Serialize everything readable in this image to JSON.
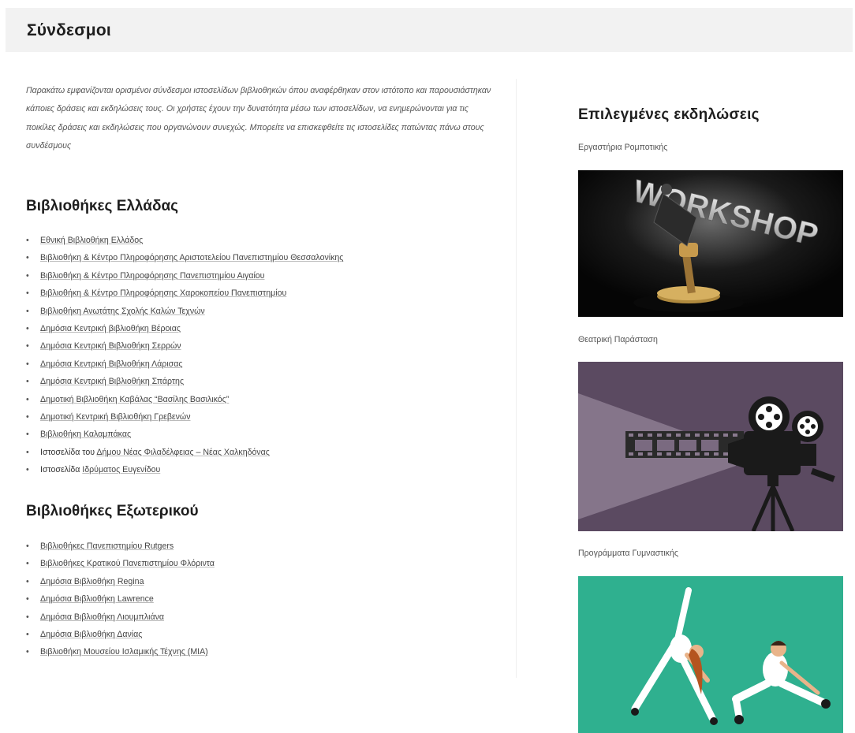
{
  "page": {
    "title": "Σύνδεσμοι",
    "intro": "Παρακάτω εμφανίζονται ορισμένοι σύνδεσμοι ιστοσελίδων βιβλιοθηκών όπου αναφέρθηκαν στον ιστότοπο και παρουσιάστηκαν κάποιες δράσεις και εκδηλώσεις τους. Οι χρήστες έχουν την δυνατότητα μέσω των ιστοσελίδων, να ενημερώνονται για τις ποικίλες δράσεις και εκδηλώσεις που οργανώνουν συνεχώς. Μπορείτε να επισκεφθείτε τις ιστοσελίδες πατώντας πάνω στους συνδέσμους"
  },
  "greece": {
    "heading": "Βιβλιοθήκες Ελλάδας",
    "links": [
      {
        "prefix": "",
        "text": "Εθνική Βιβλιοθήκη Ελλάδος"
      },
      {
        "prefix": "",
        "text": "Βιβλιοθήκη & Κέντρο Πληροφόρησης Αριστοτελείου Πανεπιστημίου Θεσσαλονίκης"
      },
      {
        "prefix": "",
        "text": "Βιβλιοθήκη & Κέντρο Πληροφόρησης Πανεπιστημίου Αιγαίου"
      },
      {
        "prefix": "",
        "text": "Βιβλιοθήκη & Κέντρο Πληροφόρησης Χαροκοπείου Πανεπιστημίου"
      },
      {
        "prefix": "",
        "text": "Βιβλιοθήκη Ανωτάτης Σχολής Καλών Τεχνών"
      },
      {
        "prefix": "",
        "text": "Δημόσια Κεντρική βιβλιοθήκη Βέροιας"
      },
      {
        "prefix": "",
        "text": "Δημόσια Κεντρική Βιβλιοθήκη Σερρών"
      },
      {
        "prefix": "",
        "text": "Δημόσια Κεντρική Βιβλιοθήκη Λάρισας"
      },
      {
        "prefix": "",
        "text": "Δημόσια Κεντρική Βιβλιοθήκη Σπάρτης"
      },
      {
        "prefix": "",
        "text": "Δημοτική Βιβλιοθήκη Καβάλας “Βασίλης Βασιλικός”"
      },
      {
        "prefix": "",
        "text": "Δημοτική Κεντρική Βιβλιοθήκη Γρεβενών"
      },
      {
        "prefix": "",
        "text": "Βιβλιοθήκη Καλαμπάκας"
      },
      {
        "prefix": "Ιστοσελίδα του ",
        "text": "Δήμου Νέας Φιλαδέλφειας – Νέας Χαλκηδόνας"
      },
      {
        "prefix": "Ιστοσελίδα ",
        "text": "Ιδρύματος Ευγενίδου"
      }
    ]
  },
  "abroad": {
    "heading": "Βιβλιοθήκες Εξωτερικού",
    "links": [
      {
        "prefix": "",
        "text": "Βιβλιοθήκες Πανεπιστημίου Rutgers"
      },
      {
        "prefix": "",
        "text": "Βιβλιοθήκες Κρατικού Πανεπιστημίου Φλόριντα"
      },
      {
        "prefix": "",
        "text": "Δημόσια Βιβλιοθήκη Regina"
      },
      {
        "prefix": "",
        "text": "Δημόσια Βιβλιοθήκη Lawrence"
      },
      {
        "prefix": "",
        "text": "Δημόσια Βιβλιοθήκη Λιουμπλιάνα"
      },
      {
        "prefix": "",
        "text": "Δημόσια Βιβλιοθήκη Δανίας"
      },
      {
        "prefix": "",
        "text": "Βιβλιοθήκη Μουσείου Ισλαμικής Τέχνης (MIA)"
      }
    ]
  },
  "events": {
    "heading": "Επιλεγμένες εκδηλώσεις",
    "items": [
      {
        "title": "Εργαστήρια Ρομποτικής",
        "image_text": "WORKSHOP",
        "icon": "workshop-lamp-image"
      },
      {
        "title": "Θεατρική Παράσταση",
        "icon": "film-projector-image"
      },
      {
        "title": "Προγράμματα Γυμναστικής",
        "icon": "exercise-people-image"
      }
    ]
  },
  "colors": {
    "title_bar_bg": "#f2f2f2",
    "projector_bg": "#5b4a61",
    "gym_bg": "#2fb08f"
  }
}
